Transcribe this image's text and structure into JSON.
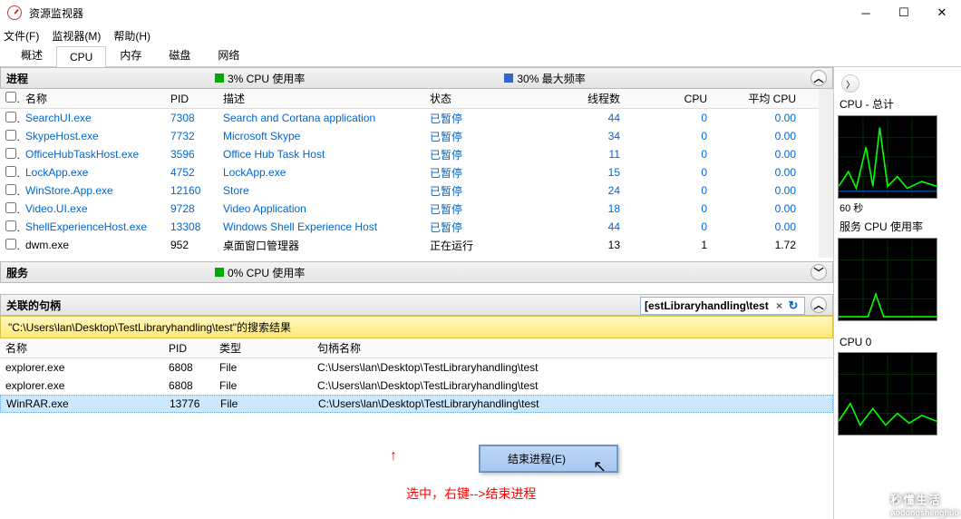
{
  "window": {
    "title": "资源监视器"
  },
  "menu": {
    "file": "文件(F)",
    "monitor": "监视器(M)",
    "help": "帮助(H)"
  },
  "tabs": {
    "overview": "概述",
    "cpu": "CPU",
    "memory": "内存",
    "disk": "磁盘",
    "network": "网络"
  },
  "processes": {
    "title": "进程",
    "metric1": "3% CPU 使用率",
    "metric2": "30% 最大频率",
    "headers": {
      "name": "名称",
      "pid": "PID",
      "desc": "描述",
      "status": "状态",
      "threads": "线程数",
      "cpu": "CPU",
      "avg": "平均 CPU"
    },
    "rows": [
      {
        "name": "SearchUI.exe",
        "pid": "7308",
        "desc": "Search and Cortana application",
        "status": "已暂停",
        "threads": "44",
        "cpu": "0",
        "avg": "0.00"
      },
      {
        "name": "SkypeHost.exe",
        "pid": "7732",
        "desc": "Microsoft Skype",
        "status": "已暂停",
        "threads": "34",
        "cpu": "0",
        "avg": "0.00"
      },
      {
        "name": "OfficeHubTaskHost.exe",
        "pid": "3596",
        "desc": "Office Hub Task Host",
        "status": "已暂停",
        "threads": "11",
        "cpu": "0",
        "avg": "0.00"
      },
      {
        "name": "LockApp.exe",
        "pid": "4752",
        "desc": "LockApp.exe",
        "status": "已暂停",
        "threads": "15",
        "cpu": "0",
        "avg": "0.00"
      },
      {
        "name": "WinStore.App.exe",
        "pid": "12160",
        "desc": "Store",
        "status": "已暂停",
        "threads": "24",
        "cpu": "0",
        "avg": "0.00"
      },
      {
        "name": "Video.UI.exe",
        "pid": "9728",
        "desc": "Video Application",
        "status": "已暂停",
        "threads": "18",
        "cpu": "0",
        "avg": "0.00"
      },
      {
        "name": "ShellExperienceHost.exe",
        "pid": "13308",
        "desc": "Windows Shell Experience Host",
        "status": "已暂停",
        "threads": "44",
        "cpu": "0",
        "avg": "0.00"
      },
      {
        "name": "dwm.exe",
        "pid": "952",
        "desc": "桌面窗口管理器",
        "status": "正在运行",
        "threads": "13",
        "cpu": "1",
        "avg": "1.72"
      }
    ]
  },
  "services": {
    "title": "服务",
    "metric1": "0% CPU 使用率"
  },
  "handles": {
    "title": "关联的句柄",
    "search": "[estLibraryhandling\\test",
    "bar": "\"C:\\Users\\lan\\Desktop\\TestLibraryhandling\\test\"的搜索结果",
    "headers": {
      "name": "名称",
      "pid": "PID",
      "type": "类型",
      "handle": "句柄名称"
    },
    "rows": [
      {
        "name": "explorer.exe",
        "pid": "6808",
        "type": "File",
        "handle": "C:\\Users\\lan\\Desktop\\TestLibraryhandling\\test"
      },
      {
        "name": "explorer.exe",
        "pid": "6808",
        "type": "File",
        "handle": "C:\\Users\\lan\\Desktop\\TestLibraryhandling\\test"
      },
      {
        "name": "WinRAR.exe",
        "pid": "13776",
        "type": "File",
        "handle": "C:\\Users\\lan\\Desktop\\TestLibraryhandling\\test"
      }
    ]
  },
  "ctx": {
    "end": "结束进程(E)"
  },
  "annot": {
    "arrow": "↑",
    "text": "选中，右键-->结束进程"
  },
  "charts": {
    "total": "CPU - 总计",
    "sixty": "60 秒",
    "svc": "服务 CPU 使用率",
    "cpu0": "CPU 0"
  },
  "watermark": {
    "big": "秒懂生活",
    "small": "aodongshenghuo"
  }
}
